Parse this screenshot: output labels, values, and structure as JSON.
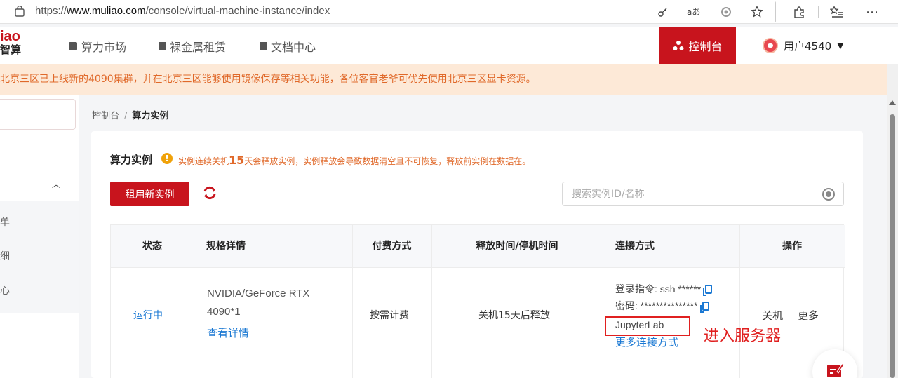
{
  "browser": {
    "url_prefix": "https://",
    "url_domain": "www.muliao.com",
    "url_path": "/console/virtual-machine-instance/index"
  },
  "logo": {
    "line1": "iao",
    "line2": "智算"
  },
  "nav": {
    "items": [
      {
        "label": "算力市场"
      },
      {
        "label": "裸金属租赁"
      },
      {
        "label": "文档中心"
      }
    ],
    "console_label": "控制台",
    "user_label": "用户4540"
  },
  "notice": "北京三区已上线新的4090集群，并在北京三区能够使用镜像保存等相关功能，各位客官老爷可优先使用北京三区显卡资源。",
  "sidebar": {
    "items": [
      {
        "label": "单"
      },
      {
        "label": "细"
      },
      {
        "label": "心"
      }
    ]
  },
  "breadcrumb": {
    "root": "控制台",
    "separator": "/",
    "current": "算力实例"
  },
  "card": {
    "title": "算力实例",
    "warn_prefix": "实例连续关机",
    "warn_days": "15",
    "warn_suffix": "天会释放实例，实例释放会导致数据清空且不可恢复，释放前实例在数据在。",
    "rent_button": "租用新实例",
    "search_placeholder": "搜索实例ID/名称"
  },
  "table": {
    "headers": [
      "状态",
      "规格详情",
      "付费方式",
      "释放时间/停机时间",
      "连接方式",
      "操作"
    ],
    "rows": [
      {
        "status": "运行中",
        "spec_line1": "NVIDIA/GeForce RTX",
        "spec_line2": "4090*1",
        "spec_link": "查看详情",
        "billing": "按需计费",
        "release": "关机15天后释放",
        "login_cmd": "登录指令: ssh ******",
        "password": "密码: ***************",
        "jupyter": "JupyterLab",
        "more_conn": "更多连接方式",
        "action_shutdown": "关机",
        "action_more": "更多"
      }
    ]
  },
  "annotation": "进入服务器",
  "colors": {
    "brand": "#c8141d",
    "link": "#1a78d3",
    "notice_bg": "#fde9d7",
    "notice_text": "#e0692a",
    "annotation": "#e02020"
  }
}
